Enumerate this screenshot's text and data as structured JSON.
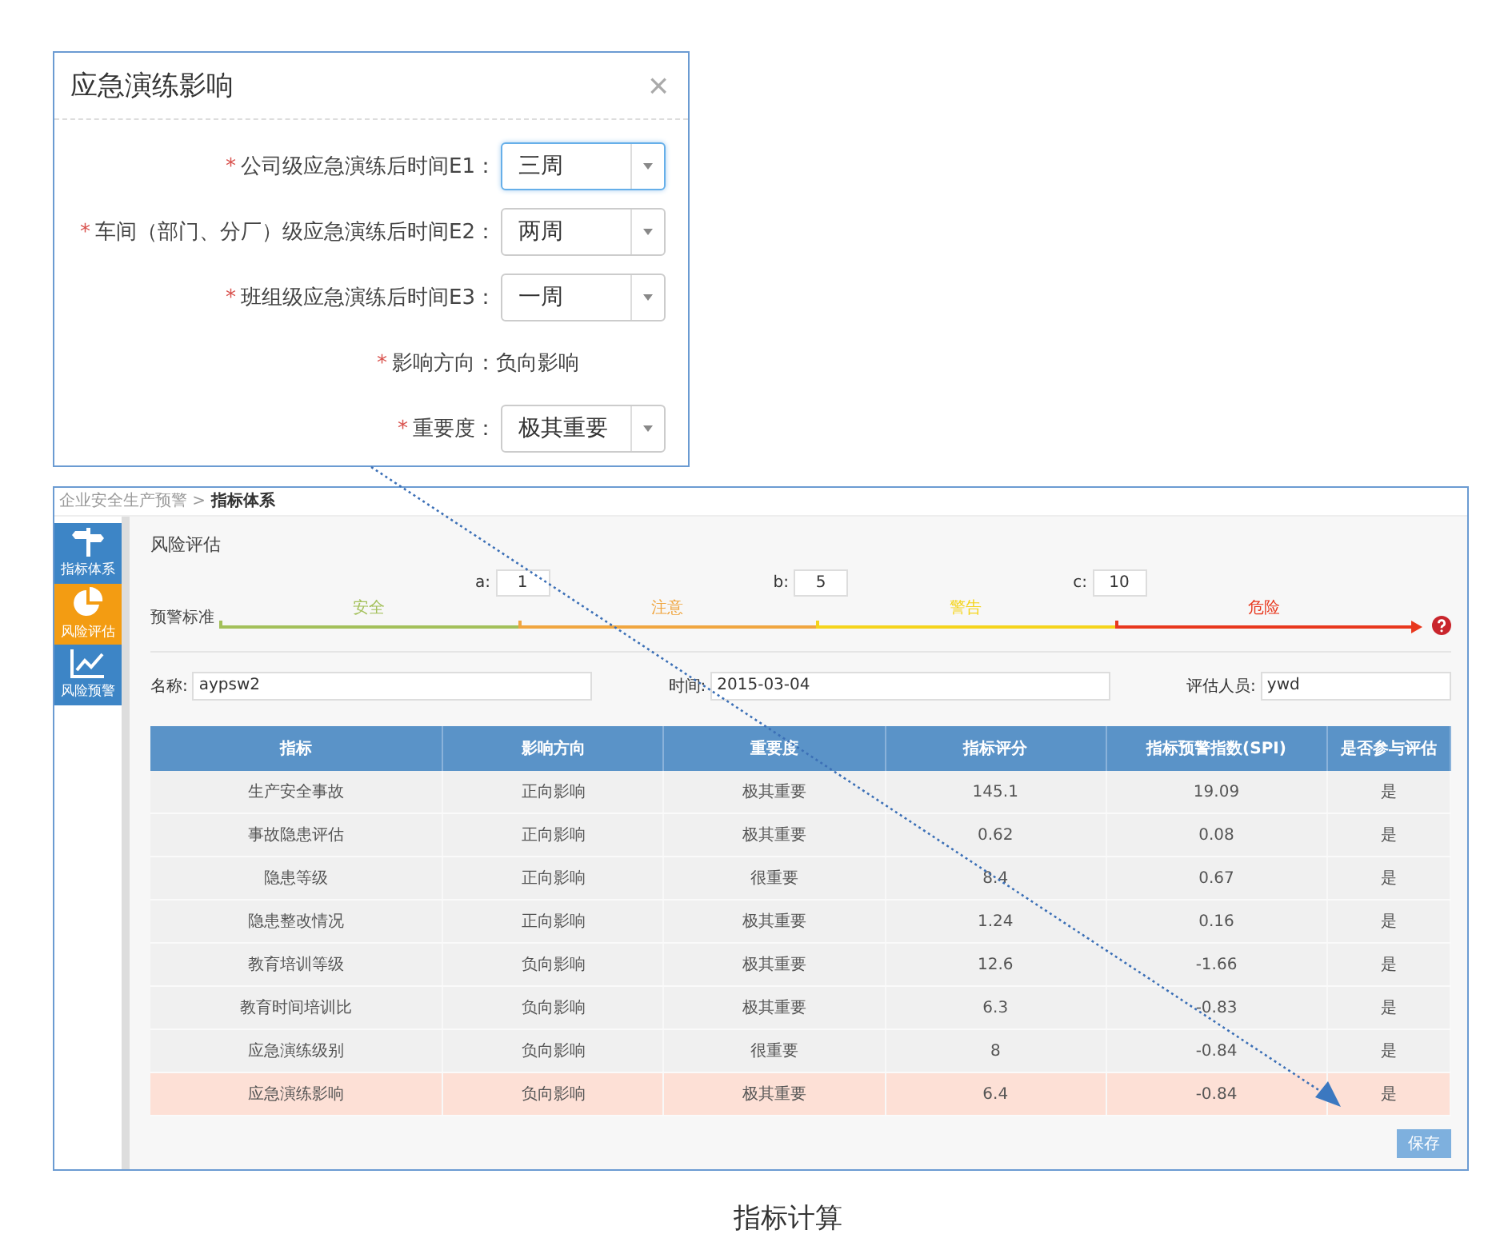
{
  "dialog": {
    "title": "应急演练影响",
    "close": "×",
    "fields": [
      {
        "kind": "select",
        "marker": "*",
        "label": "公司级应急演练后时间E1：",
        "value": "三周",
        "focused": true
      },
      {
        "kind": "select",
        "marker": "*",
        "label": "车间（部门、分厂）级应急演练后时间E2：",
        "value": "两周",
        "focused": false
      },
      {
        "kind": "select",
        "marker": "*",
        "label": "班组级应急演练后时间E3：",
        "value": "一周",
        "focused": false
      },
      {
        "kind": "text",
        "marker": "*",
        "label": "影响方向：",
        "value": "负向影响"
      },
      {
        "kind": "select",
        "marker": "*",
        "label": "重要度：",
        "value": "极其重要",
        "focused": false
      }
    ]
  },
  "app": {
    "breadcrumb": "企业安全生产预警 > **指标体系**",
    "sidebar": {
      "items": [
        {
          "kind": "signpost",
          "label": "指标体系",
          "selected": false
        },
        {
          "kind": "pie",
          "label": "风险评估",
          "selected": true
        },
        {
          "kind": "chart",
          "label": "风险预警",
          "selected": false
        }
      ]
    },
    "section_title": "风险评估",
    "warning_scale": {
      "label": "预警标准",
      "thresholds": [
        {
          "name": "a:",
          "value": "1"
        },
        {
          "name": "b:",
          "value": "5"
        },
        {
          "name": "c:",
          "value": "10"
        }
      ],
      "segments": [
        {
          "label": "安全",
          "color": "#a3c05a"
        },
        {
          "label": "注意",
          "color": "#f0a640"
        },
        {
          "label": "警告",
          "color": "#f5d41c"
        },
        {
          "label": "危险",
          "color": "#e8381e"
        }
      ]
    },
    "info_fields": [
      {
        "label": "名称:",
        "value": "aypsw2"
      },
      {
        "label": "时间:",
        "value": "2015-03-04"
      },
      {
        "label": "评估人员:",
        "value": "ywd"
      }
    ],
    "table": {
      "columns": [
        "指标",
        "影响方向",
        "重要度",
        "指标评分",
        "指标预警指数(SPI)",
        "是否参与评估"
      ],
      "rows": [
        {
          "cells": [
            "生产安全事故",
            "正向影响",
            "极其重要",
            "145.1",
            "19.09",
            "是"
          ],
          "selected": false
        },
        {
          "cells": [
            "事故隐患评估",
            "正向影响",
            "极其重要",
            "0.62",
            "0.08",
            "是"
          ],
          "selected": false
        },
        {
          "cells": [
            "隐患等级",
            "正向影响",
            "很重要",
            "8.4",
            "0.67",
            "是"
          ],
          "selected": false
        },
        {
          "cells": [
            "隐患整改情况",
            "正向影响",
            "极其重要",
            "1.24",
            "0.16",
            "是"
          ],
          "selected": false
        },
        {
          "cells": [
            "教育培训等级",
            "负向影响",
            "极其重要",
            "12.6",
            "-1.66",
            "是"
          ],
          "selected": false
        },
        {
          "cells": [
            "教育时间培训比",
            "负向影响",
            "极其重要",
            "6.3",
            "-0.83",
            "是"
          ],
          "selected": false
        },
        {
          "cells": [
            "应急演练级别",
            "负向影响",
            "很重要",
            "8",
            "-0.84",
            "是"
          ],
          "selected": false
        },
        {
          "cells": [
            "应急演练影响",
            "负向影响",
            "极其重要",
            "6.4",
            "-0.84",
            "是"
          ],
          "selected": true
        }
      ]
    },
    "save_button": "保存"
  },
  "caption": "指标计算"
}
